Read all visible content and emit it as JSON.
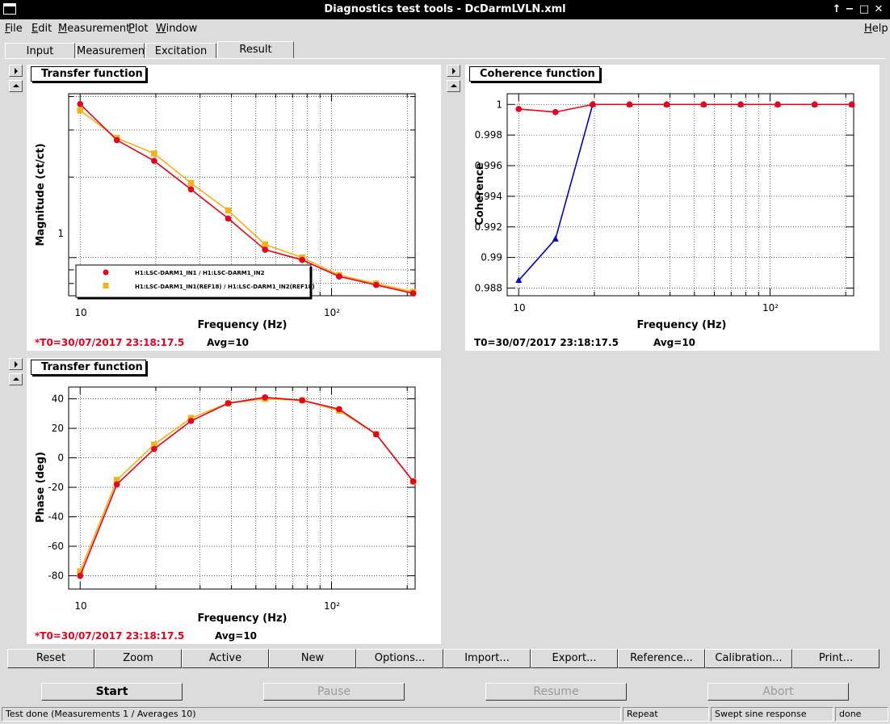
{
  "window": {
    "title": "Diagnostics test tools - DcDarmLVLN.xml",
    "controls": [
      "↑",
      "−",
      "□",
      "✕"
    ]
  },
  "menu": [
    {
      "label": "File",
      "u": "F",
      "rest": "ile"
    },
    {
      "label": "Edit",
      "u": "E",
      "rest": "dit"
    },
    {
      "label": "Measurement",
      "u": "M",
      "rest": "easurement"
    },
    {
      "label": "Plot",
      "u": "P",
      "rest": "lot"
    },
    {
      "label": "Window",
      "u": "W",
      "rest": "indow"
    }
  ],
  "help_menu": {
    "label": "Help",
    "u": "H",
    "rest": "elp"
  },
  "tabs": [
    "Input",
    "Measurement",
    "Excitation",
    "Result"
  ],
  "active_tab": "Result",
  "colors": {
    "series_measured": "#e8001c",
    "series_reference": "#f2b21a",
    "coherence_blue": "#0000d0",
    "annotation_red": "#e8001c"
  },
  "plots": {
    "magnitude": {
      "title": "Transfer function",
      "xlabel": "Frequency (Hz)",
      "ylabel": "Magnitude (ct/ct)",
      "x_ticklabels": [
        "10",
        "10²"
      ],
      "y_ticklabels": [
        "1"
      ],
      "legend": [
        "H1:LSC-DARM1_IN1 / H1:LSC-DARM1_IN2",
        "H1:LSC-DARM1_IN1(REF18) / H1:LSC-DARM1_IN2(REF18)"
      ],
      "footer_t0": "*T0=30/07/2017 23:18:17.5",
      "footer_avg": "Avg=10"
    },
    "coherence": {
      "title": "Coherence function",
      "xlabel": "Frequency (Hz)",
      "ylabel": "Coherence",
      "x_ticklabels": [
        "10",
        "10²"
      ],
      "y_ticklabels": [
        "1",
        "0.998",
        "0.996",
        "0.994",
        "0.992",
        "0.99",
        "0.988"
      ],
      "footer_t0": "T0=30/07/2017 23:18:17.5",
      "footer_avg": "Avg=10"
    },
    "phase": {
      "title": "Transfer function",
      "xlabel": "Frequency (Hz)",
      "ylabel": "Phase (deg)",
      "x_ticklabels": [
        "10",
        "10²"
      ],
      "y_ticklabels": [
        "40",
        "20",
        "0",
        "-20",
        "-40",
        "-60",
        "-80"
      ],
      "footer_t0": "*T0=30/07/2017 23:18:17.5",
      "footer_avg": "Avg=10"
    }
  },
  "chart_data": [
    {
      "type": "line",
      "title": "Transfer function",
      "xlabel": "Frequency (Hz)",
      "ylabel": "Magnitude (ct/ct)",
      "xscale": "log",
      "yscale": "log",
      "xlim": [
        9,
        215
      ],
      "ylim": [
        0.72,
        4.1
      ],
      "grid": true,
      "legend_position": "bottom-left",
      "x": [
        10,
        14,
        19.7,
        27.6,
        38.8,
        54.4,
        76.4,
        107.2,
        150.5,
        211.3
      ],
      "series": [
        {
          "name": "H1:LSC-DARM1_IN1 / H1:LSC-DARM1_IN2",
          "values": [
            3.75,
            2.75,
            2.3,
            1.8,
            1.4,
            1.07,
            0.98,
            0.85,
            0.79,
            0.735
          ]
        },
        {
          "name": "H1:LSC-DARM1_IN1(REF18) / H1:LSC-DARM1_IN2(REF18)",
          "values": [
            3.55,
            2.8,
            2.45,
            1.9,
            1.5,
            1.12,
            1.0,
            0.86,
            0.8,
            0.745
          ]
        }
      ]
    },
    {
      "type": "line",
      "title": "Coherence function",
      "xlabel": "Frequency (Hz)",
      "ylabel": "Coherence",
      "xscale": "log",
      "xlim": [
        9,
        215
      ],
      "ylim": [
        0.9875,
        1.0007
      ],
      "grid": true,
      "x": [
        10,
        14,
        19.7,
        27.6,
        38.8,
        54.4,
        76.4,
        107.2,
        150.5,
        211.3
      ],
      "series": [
        {
          "values": [
            0.9997,
            0.9995,
            1.0,
            1.0,
            1.0,
            1.0,
            1.0,
            1.0,
            1.0,
            1.0
          ]
        },
        {
          "values": [
            0.9885,
            0.9912,
            1.0,
            1.0,
            1.0,
            1.0,
            1.0,
            1.0,
            1.0,
            1.0
          ]
        }
      ]
    },
    {
      "type": "line",
      "title": "Transfer function",
      "xlabel": "Frequency (Hz)",
      "ylabel": "Phase (deg)",
      "xscale": "log",
      "xlim": [
        9,
        215
      ],
      "ylim": [
        -89,
        48
      ],
      "grid": true,
      "x": [
        10,
        14,
        19.7,
        27.6,
        38.8,
        54.4,
        76.4,
        107.2,
        150.5,
        211.3
      ],
      "series": [
        {
          "name": "H1:LSC-DARM1_IN1 / H1:LSC-DARM1_IN2",
          "values": [
            -80,
            -18,
            6,
            25,
            37,
            41,
            39,
            33,
            16,
            -16
          ]
        },
        {
          "name": "H1:LSC-DARM1_IN1(REF18) / H1:LSC-DARM1_IN2(REF18)",
          "values": [
            -77,
            -15,
            9,
            27,
            37,
            40,
            39,
            32,
            16,
            -16
          ]
        }
      ]
    }
  ],
  "graph_buttons": [
    "Reset",
    "Zoom",
    "Active",
    "New",
    "Options...",
    "Import...",
    "Export...",
    "Reference...",
    "Calibration...",
    "Print..."
  ],
  "control_buttons": {
    "start": "Start",
    "pause": "Pause",
    "resume": "Resume",
    "abort": "Abort"
  },
  "status": {
    "message": "Test done (Measurements 1 / Averages 10)",
    "mode": "Repeat",
    "type": "Swept sine response",
    "state": "done"
  }
}
